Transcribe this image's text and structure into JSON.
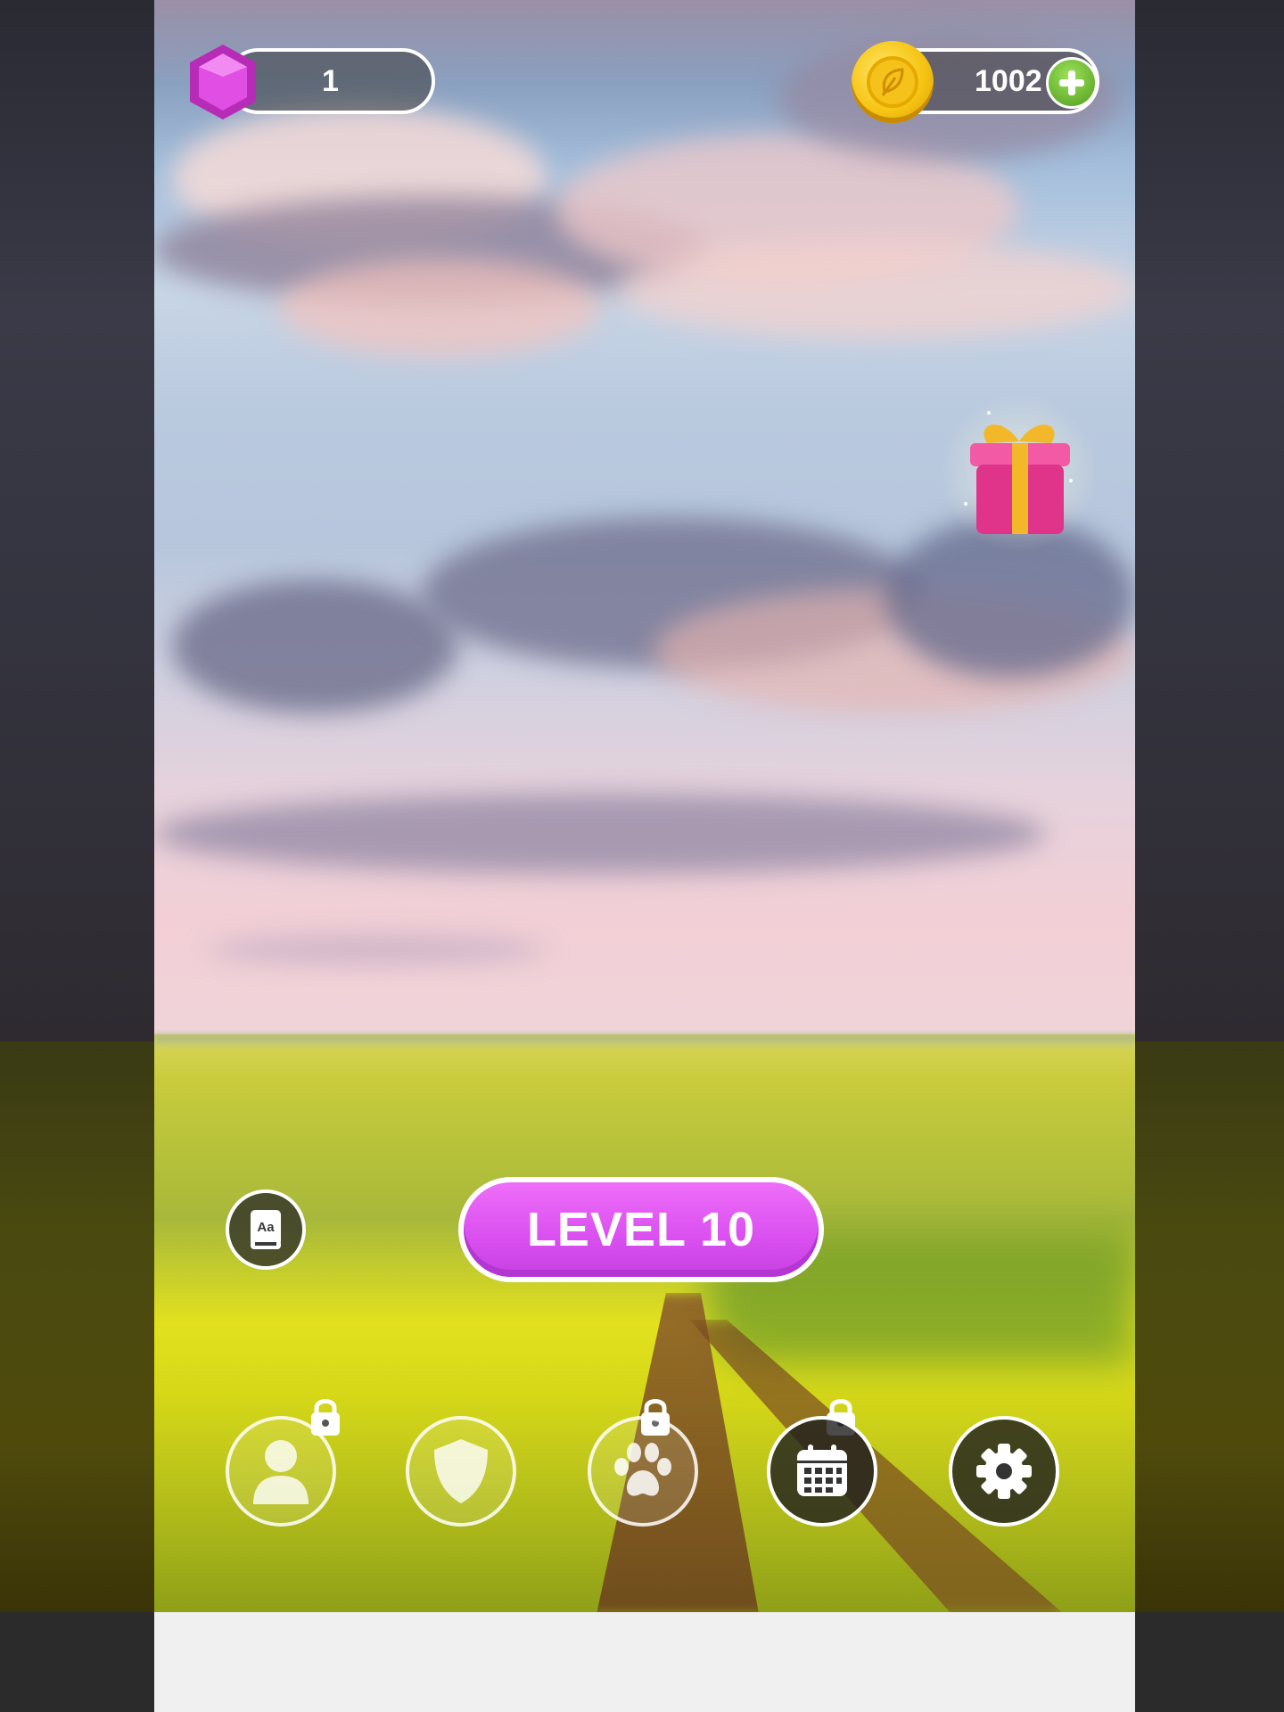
{
  "hud": {
    "gems": "1",
    "coins": "1002"
  },
  "level": {
    "label": "LEVEL 10"
  },
  "nav": [
    {
      "name": "profile",
      "icon": "user-icon",
      "locked": true
    },
    {
      "name": "shield",
      "icon": "shield-icon",
      "locked": true
    },
    {
      "name": "pets",
      "icon": "paw-icon",
      "locked": true
    },
    {
      "name": "calendar",
      "icon": "calendar-icon",
      "locked": false
    },
    {
      "name": "settings",
      "icon": "gear-icon",
      "locked": false
    }
  ],
  "colors": {
    "level_button": "#d94ff0",
    "gem": "#d63fd6",
    "coin": "#f6c514",
    "plus": "#4f9d1e",
    "gift_box": "#e0338a",
    "gift_ribbon": "#f2b82a"
  }
}
